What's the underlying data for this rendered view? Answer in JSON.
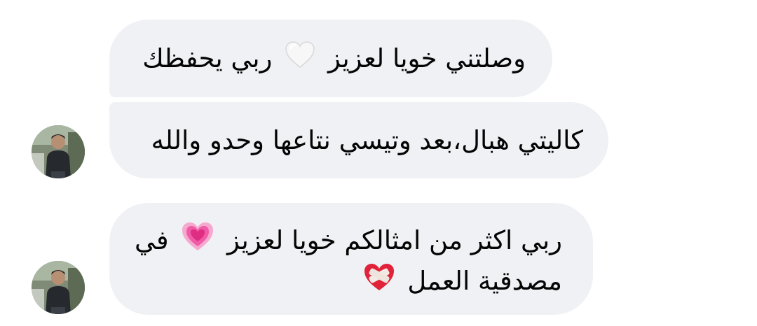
{
  "messages": [
    {
      "text_part1": "وصلتني خويا لعزيز",
      "emoji": "white-heart-icon",
      "text_part2": "ربي يحفظك",
      "show_avatar": false
    },
    {
      "text": "كاليتي هبال،بعد  وتيسي نتاعها وحدو والله",
      "show_avatar": true
    },
    {
      "text_part1": "ربي اكثر من امثالكم خويا لعزيز",
      "emoji": "growing-heart-icon",
      "text_part2": "في مصدقية العمل",
      "emoji2": "mending-heart-icon",
      "show_avatar": true
    }
  ],
  "colors": {
    "bubble_bg": "#f0f1f4",
    "text": "#050505",
    "pink_heart": "#ee3a8c",
    "red_heart": "#e0223a"
  }
}
